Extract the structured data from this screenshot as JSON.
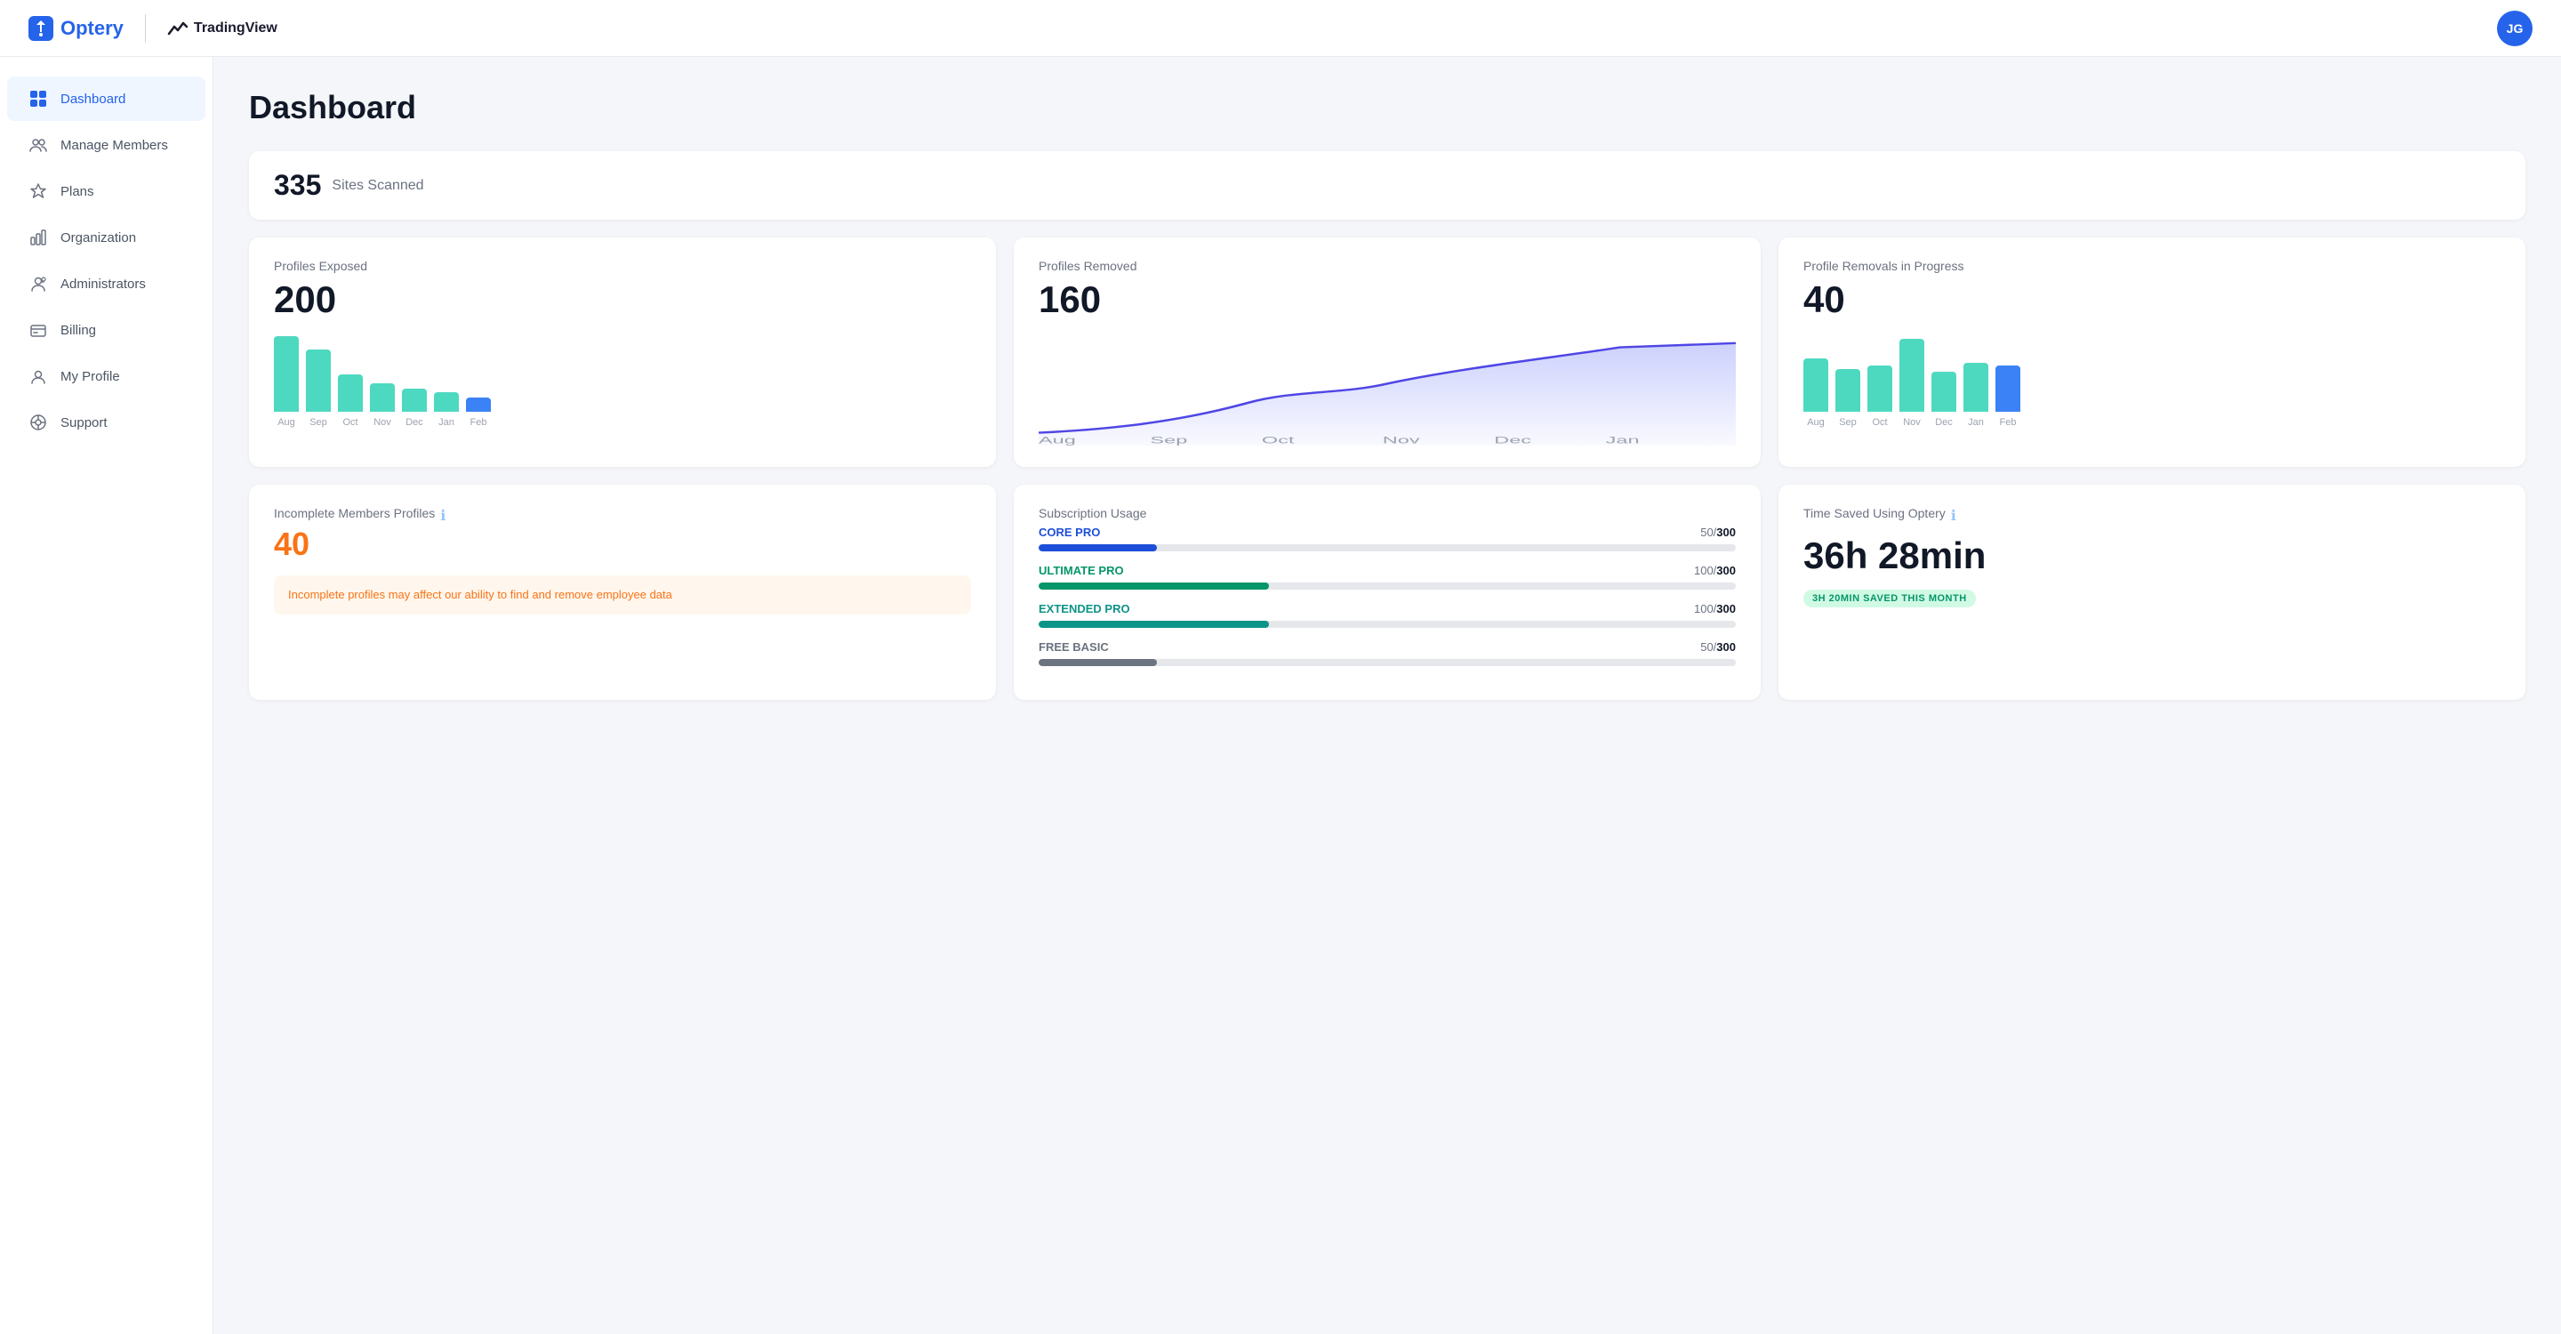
{
  "header": {
    "brand": "Optery",
    "partner": "TradingView",
    "avatar_initials": "JG"
  },
  "sidebar": {
    "items": [
      {
        "id": "dashboard",
        "label": "Dashboard",
        "active": true
      },
      {
        "id": "manage-members",
        "label": "Manage Members",
        "active": false
      },
      {
        "id": "plans",
        "label": "Plans",
        "active": false
      },
      {
        "id": "organization",
        "label": "Organization",
        "active": false
      },
      {
        "id": "administrators",
        "label": "Administrators",
        "active": false
      },
      {
        "id": "billing",
        "label": "Billing",
        "active": false
      },
      {
        "id": "my-profile",
        "label": "My Profile",
        "active": false
      },
      {
        "id": "support",
        "label": "Support",
        "active": false
      }
    ]
  },
  "main": {
    "page_title": "Dashboard",
    "sites_scanned": "335",
    "sites_scanned_label": "Sites Scanned"
  },
  "profiles_exposed": {
    "label": "Profiles Exposed",
    "value": "200",
    "bars": [
      {
        "month": "Aug",
        "height": 85,
        "color": "#4dd9c0"
      },
      {
        "month": "Sep",
        "height": 70,
        "color": "#4dd9c0"
      },
      {
        "month": "Oct",
        "height": 42,
        "color": "#4dd9c0"
      },
      {
        "month": "Nov",
        "height": 32,
        "color": "#4dd9c0"
      },
      {
        "month": "Dec",
        "height": 26,
        "color": "#4dd9c0"
      },
      {
        "month": "Jan",
        "height": 22,
        "color": "#4dd9c0"
      },
      {
        "month": "Feb",
        "height": 16,
        "color": "#3b82f6"
      }
    ]
  },
  "profiles_removed": {
    "label": "Profiles Removed",
    "value": "160",
    "months": [
      "Aug",
      "Sep",
      "Oct",
      "Nov",
      "Dec",
      "Jan"
    ],
    "points": [
      10,
      18,
      55,
      50,
      60,
      95
    ]
  },
  "profile_removals": {
    "label": "Profile Removals in Progress",
    "value": "40",
    "bars": [
      {
        "month": "Aug",
        "height": 60,
        "color": "#4dd9c0"
      },
      {
        "month": "Sep",
        "height": 48,
        "color": "#4dd9c0"
      },
      {
        "month": "Oct",
        "height": 52,
        "color": "#4dd9c0"
      },
      {
        "month": "Nov",
        "height": 82,
        "color": "#4dd9c0"
      },
      {
        "month": "Dec",
        "height": 45,
        "color": "#4dd9c0"
      },
      {
        "month": "Jan",
        "height": 55,
        "color": "#4dd9c0"
      },
      {
        "month": "Feb",
        "height": 52,
        "color": "#3b82f6"
      }
    ]
  },
  "incomplete_profiles": {
    "label": "Incomplete Members Profiles",
    "value": "40",
    "warning": "Incomplete profiles may affect our ability to find and remove employee data"
  },
  "subscription_usage": {
    "label": "Subscription Usage",
    "items": [
      {
        "name": "CORE PRO",
        "used": 50,
        "total": 300,
        "color": "#1d4ed8",
        "percent": 17
      },
      {
        "name": "ULTIMATE PRO",
        "used": 100,
        "total": 300,
        "color": "#059669",
        "percent": 33
      },
      {
        "name": "EXTENDED PRO",
        "used": 100,
        "total": 300,
        "color": "#0d9488",
        "percent": 33
      },
      {
        "name": "FREE BASIC",
        "used": 50,
        "total": 300,
        "color": "#6b7280",
        "percent": 17
      }
    ]
  },
  "time_saved": {
    "label": "Time Saved Using Optery",
    "value": "36h 28min",
    "badge": "3H 20MIN SAVED THIS MONTH"
  }
}
